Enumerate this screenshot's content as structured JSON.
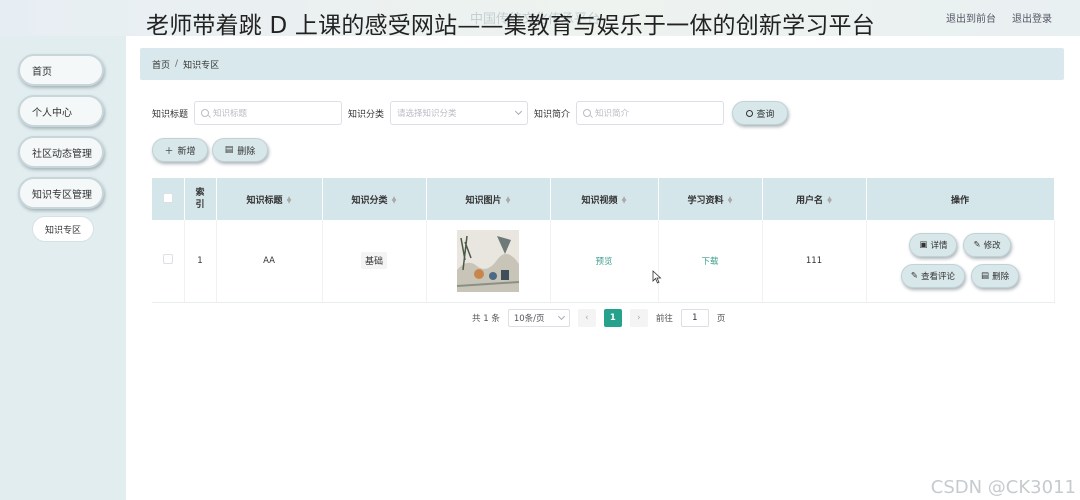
{
  "overlay_title": "老师带着跳 D 上课的感受网站——集教育与娱乐于一体的创新学习平台",
  "ghost_title": "中国传统文化传承平台",
  "header": {
    "links": [
      "退出到前台",
      "退出登录"
    ]
  },
  "sidebar": {
    "items": [
      {
        "label": "首页"
      },
      {
        "label": "个人中心"
      },
      {
        "label": "社区动态管理"
      },
      {
        "label": "知识专区管理"
      }
    ],
    "sub_item": "知识专区"
  },
  "breadcrumb": {
    "home": "首页",
    "separator": "/",
    "current": "知识专区"
  },
  "search": {
    "title_label": "知识标题",
    "title_placeholder": "知识标题",
    "category_label": "知识分类",
    "category_placeholder": "请选择知识分类",
    "intro_label": "知识简介",
    "intro_placeholder": "知识简介",
    "query_button": "查询"
  },
  "actions": {
    "add": "新增",
    "delete": "删除"
  },
  "table": {
    "headers": [
      "索引",
      "知识标题",
      "知识分类",
      "知识图片",
      "知识视频",
      "学习资料",
      "用户名",
      "操作"
    ],
    "rows": [
      {
        "index": "1",
        "title": "AA",
        "category": "基础",
        "video": "预览",
        "material": "下载",
        "username": "111",
        "ops": [
          "详情",
          "修改",
          "查看评论",
          "删除"
        ]
      }
    ]
  },
  "pagination": {
    "total_prefix": "共",
    "total": "1",
    "total_suffix": "条",
    "page_size": "10条/页",
    "current_page": "1",
    "goto_label": "前往",
    "goto_value": "1",
    "goto_suffix": "页"
  },
  "watermark": "CSDN @CK3011",
  "colors": {
    "accent": "#26a18c",
    "header_bg": "#d5e6ea",
    "sidebar_bg": "#e2edf0"
  }
}
